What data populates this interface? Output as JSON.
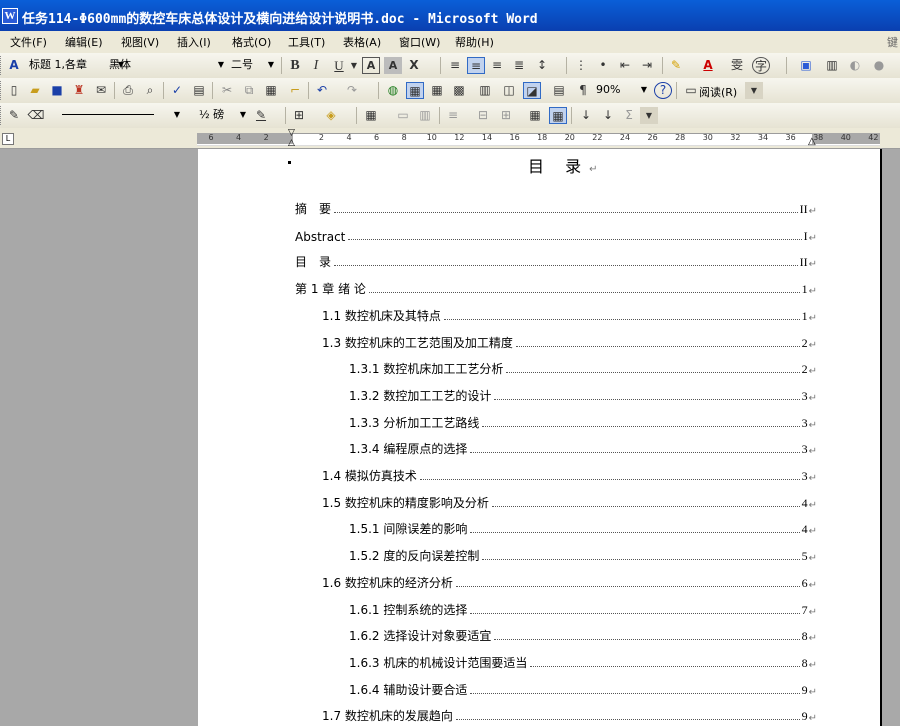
{
  "window": {
    "title": "任务114-Φ600mm的数控车床总体设计及横向进给设计说明书.doc - Microsoft Word"
  },
  "menu": {
    "items": [
      "文件(F)",
      "编辑(E)",
      "视图(V)",
      "插入(I)",
      "格式(O)",
      "工具(T)",
      "表格(A)",
      "窗口(W)",
      "帮助(H)"
    ],
    "right_hint": "键"
  },
  "formatting": {
    "style_value": "标题 1,各章",
    "font_value": "黑体",
    "size_value": "二号"
  },
  "standard": {
    "zoom_value": "90%",
    "reading_label": "阅读(R)"
  },
  "drawing": {
    "line_weight_label": "½ 磅"
  },
  "ruler": {
    "ticks": [
      "6",
      "4",
      "2",
      "",
      "2",
      "4",
      "6",
      "8",
      "10",
      "12",
      "14",
      "16",
      "18",
      "20",
      "22",
      "24",
      "26",
      "28",
      "30",
      "32",
      "34",
      "36",
      "38",
      "40",
      "42"
    ]
  },
  "document": {
    "toc_title": "目  录",
    "entries": [
      {
        "text": "摘　要",
        "page": "II"
      },
      {
        "text": "Abstract",
        "page": "I"
      },
      {
        "text": "目　录",
        "page": "II"
      },
      {
        "text": "第 1 章  绪  论",
        "page": "1"
      },
      {
        "text": "1.1 数控机床及其特点",
        "page": "1"
      },
      {
        "text": "1.3  数控机床的工艺范围及加工精度",
        "page": "2"
      },
      {
        "text": "1.3.1 数控机床加工工艺分析",
        "page": "2"
      },
      {
        "text": "1.3.2 数控加工工艺的设计",
        "page": "3"
      },
      {
        "text": "1.3.3 分析加工工艺路线",
        "page": "3"
      },
      {
        "text": "1.3.4 编程原点的选择",
        "page": "3"
      },
      {
        "text": "1.4  模拟仿真技术",
        "page": "3"
      },
      {
        "text": "1.5  数控机床的精度影响及分析",
        "page": "4"
      },
      {
        "text": "1.5.1  间隙误差的影响",
        "page": "4"
      },
      {
        "text": "1.5.2 度的反向误差控制",
        "page": "5"
      },
      {
        "text": "1.6 数控机床的经济分析",
        "page": "6"
      },
      {
        "text": "1.6.1 控制系统的选择",
        "page": "7"
      },
      {
        "text": "1.6.2  选择设计对象要适宜",
        "page": "8"
      },
      {
        "text": "1.6.3  机床的机械设计范围要适当",
        "page": "8"
      },
      {
        "text": "1.6.4  辅助设计要合适",
        "page": "9"
      },
      {
        "text": "1.7 数控机床的发展趋向",
        "page": "9"
      }
    ]
  }
}
